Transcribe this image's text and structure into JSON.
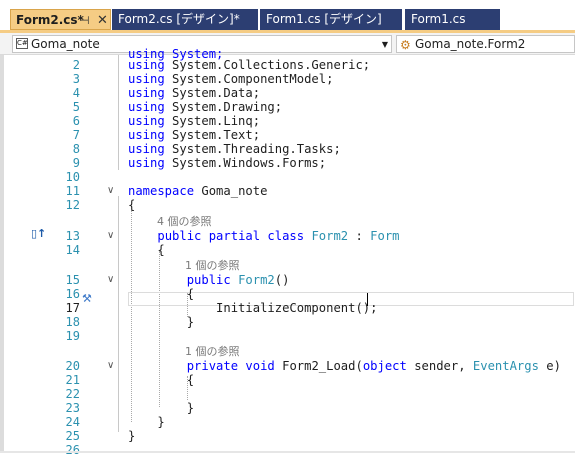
{
  "tabs": [
    {
      "label": "Form2.cs*",
      "active": true,
      "pin": "⊣",
      "close": "✕"
    },
    {
      "label": "Form2.cs [デザイン]*",
      "active": false
    },
    {
      "label": "Form1.cs [デザイン]",
      "active": false
    },
    {
      "label": "Form1.cs",
      "active": false
    }
  ],
  "navbar": {
    "project_combo": {
      "icon": "C#",
      "label": "Goma_note"
    },
    "type_combo": {
      "label": "Goma_note.Form2"
    }
  },
  "editor": {
    "partial_top_line": "using System;",
    "lines": [
      {
        "n": "2",
        "parts": [
          [
            "kw",
            "using"
          ],
          [
            "plain",
            " System.Collections.Generic;"
          ]
        ]
      },
      {
        "n": "3",
        "parts": [
          [
            "kw",
            "using"
          ],
          [
            "plain",
            " System.ComponentModel;"
          ]
        ]
      },
      {
        "n": "4",
        "parts": [
          [
            "kw",
            "using"
          ],
          [
            "plain",
            " System.Data;"
          ]
        ]
      },
      {
        "n": "5",
        "parts": [
          [
            "kw",
            "using"
          ],
          [
            "plain",
            " System.Drawing;"
          ]
        ]
      },
      {
        "n": "6",
        "parts": [
          [
            "kw",
            "using"
          ],
          [
            "plain",
            " System.Linq;"
          ]
        ]
      },
      {
        "n": "7",
        "parts": [
          [
            "kw",
            "using"
          ],
          [
            "plain",
            " System.Text;"
          ]
        ]
      },
      {
        "n": "8",
        "parts": [
          [
            "kw",
            "using"
          ],
          [
            "plain",
            " System.Threading.Tasks;"
          ]
        ]
      },
      {
        "n": "9",
        "parts": [
          [
            "kw",
            "using"
          ],
          [
            "plain",
            " System.Windows.Forms;"
          ]
        ]
      },
      {
        "n": "10",
        "parts": []
      },
      {
        "n": "11",
        "parts": [
          [
            "kw",
            "namespace"
          ],
          [
            "plain",
            " Goma_note"
          ]
        ]
      },
      {
        "n": "12",
        "parts": [
          [
            "plain",
            "{"
          ]
        ]
      },
      {
        "lens": "4 個の参照"
      },
      {
        "n": "13",
        "parts": [
          [
            "plain",
            "    "
          ],
          [
            "kw",
            "public partial class"
          ],
          [
            "plain",
            " "
          ],
          [
            "type",
            "Form2"
          ],
          [
            "plain",
            " : "
          ],
          [
            "type",
            "Form"
          ]
        ]
      },
      {
        "n": "14",
        "parts": [
          [
            "plain",
            "    {"
          ]
        ]
      },
      {
        "lens": "1 個の参照"
      },
      {
        "n": "15",
        "parts": [
          [
            "plain",
            "        "
          ],
          [
            "kw",
            "public"
          ],
          [
            "plain",
            " "
          ],
          [
            "type",
            "Form2"
          ],
          [
            "plain",
            "()"
          ]
        ]
      },
      {
        "n": "16",
        "parts": [
          [
            "plain",
            "        {"
          ]
        ]
      },
      {
        "n": "17",
        "parts": [
          [
            "plain",
            "            InitializeComponent();"
          ]
        ]
      },
      {
        "n": "18",
        "parts": [
          [
            "plain",
            "        }"
          ]
        ]
      },
      {
        "n": "19",
        "parts": []
      },
      {
        "lens": "1 個の参照"
      },
      {
        "n": "20",
        "parts": [
          [
            "plain",
            "        "
          ],
          [
            "kw",
            "private void"
          ],
          [
            "plain",
            " Form2_Load("
          ],
          [
            "kw",
            "object"
          ],
          [
            "plain",
            " sender, "
          ],
          [
            "type",
            "EventArgs"
          ],
          [
            "plain",
            " e)"
          ]
        ]
      },
      {
        "n": "21",
        "parts": [
          [
            "plain",
            "        {"
          ]
        ]
      },
      {
        "n": "22",
        "parts": []
      },
      {
        "n": "23",
        "parts": [
          [
            "plain",
            "        }"
          ]
        ]
      },
      {
        "n": "24",
        "parts": [
          [
            "plain",
            "    }"
          ]
        ]
      },
      {
        "n": "25",
        "parts": [
          [
            "plain",
            "}"
          ]
        ]
      },
      {
        "n": "26",
        "parts": []
      }
    ],
    "current_line": "17",
    "colors": {
      "keyword": "#0000ff",
      "type": "#2b91af",
      "line_number": "#2b91af",
      "tab_active": "#f5cc84",
      "tab_inactive": "#2c3e72"
    }
  }
}
